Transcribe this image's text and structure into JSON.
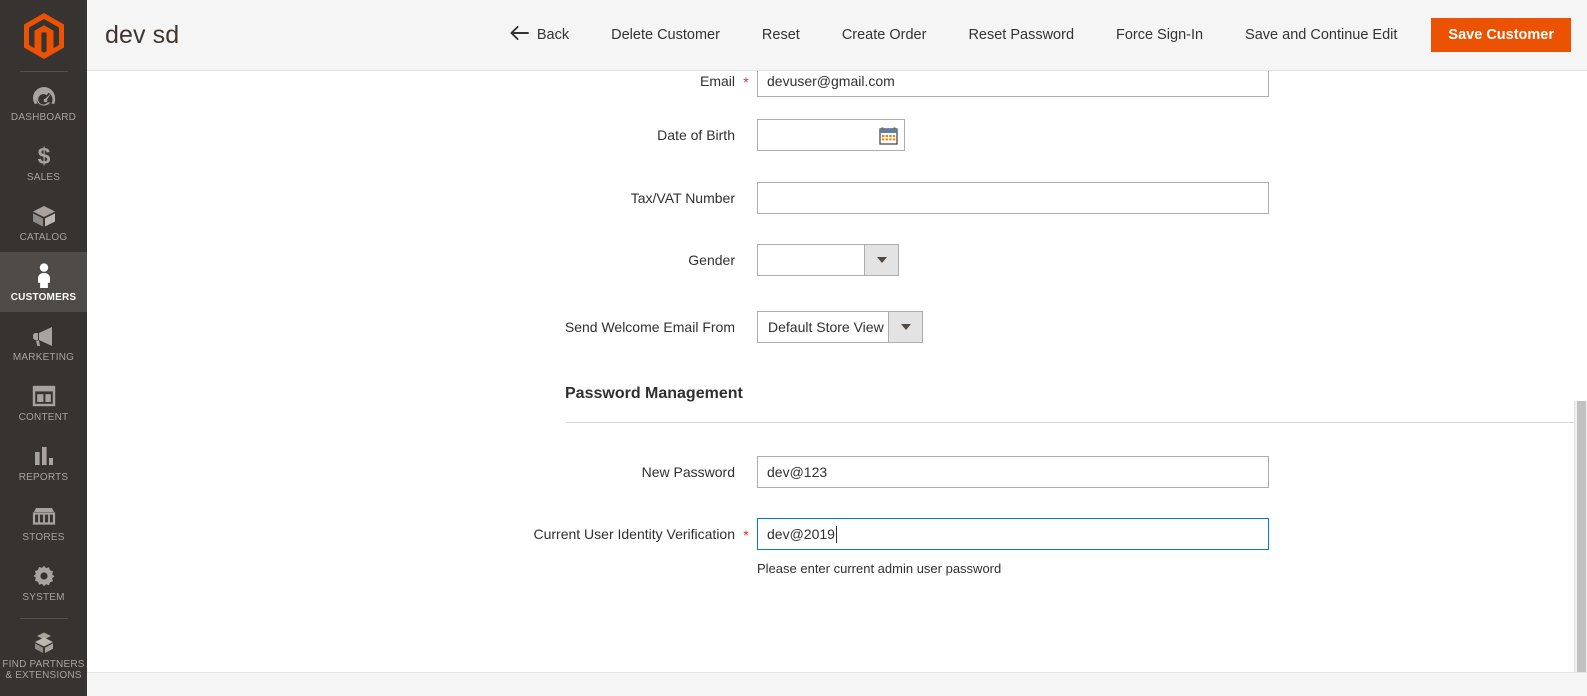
{
  "sidebar": {
    "logo_name": "magento-logo",
    "items": [
      {
        "label": "DASHBOARD",
        "icon": "dashboard-icon",
        "active": false
      },
      {
        "label": "SALES",
        "icon": "dollar-icon",
        "active": false
      },
      {
        "label": "CATALOG",
        "icon": "box-icon",
        "active": false
      },
      {
        "label": "CUSTOMERS",
        "icon": "person-icon",
        "active": true
      },
      {
        "label": "MARKETING",
        "icon": "megaphone-icon",
        "active": false
      },
      {
        "label": "CONTENT",
        "icon": "layout-icon",
        "active": false
      },
      {
        "label": "REPORTS",
        "icon": "bar-chart-icon",
        "active": false
      },
      {
        "label": "STORES",
        "icon": "storefront-icon",
        "active": false
      },
      {
        "label": "SYSTEM",
        "icon": "gear-icon",
        "active": false
      },
      {
        "label": "FIND PARTNERS\n& EXTENSIONS",
        "label_line1": "FIND PARTNERS",
        "label_line2": "& EXTENSIONS",
        "icon": "partners-box-icon",
        "active": false
      }
    ]
  },
  "header": {
    "title": "dev sd",
    "actions": [
      {
        "label": "Back",
        "icon": "arrow-left-icon",
        "primary": false
      },
      {
        "label": "Delete Customer",
        "primary": false
      },
      {
        "label": "Reset",
        "primary": false
      },
      {
        "label": "Create Order",
        "primary": false
      },
      {
        "label": "Reset Password",
        "primary": false
      },
      {
        "label": "Force Sign-In",
        "primary": false
      },
      {
        "label": "Save and Continue Edit",
        "primary": false
      }
    ],
    "save_label": "Save Customer"
  },
  "form": {
    "fields": [
      {
        "label": "Email",
        "required": true,
        "value": "devuser@gmail.com",
        "type": "text"
      },
      {
        "label": "Date of Birth",
        "required": false,
        "value": "",
        "type": "date"
      },
      {
        "label": "Tax/VAT Number",
        "required": false,
        "value": "",
        "type": "text"
      },
      {
        "label": "Gender",
        "required": false,
        "value": "",
        "type": "select"
      },
      {
        "label": "Send Welcome Email From",
        "required": false,
        "value": "Default Store View",
        "type": "select"
      }
    ],
    "password_section": {
      "heading": "Password Management",
      "new_password": {
        "label": "New Password",
        "required": false,
        "value": "dev@123"
      },
      "identity_verification": {
        "label": "Current User Identity Verification",
        "required": true,
        "value": "dev@2019",
        "help": "Please enter current admin user password",
        "focused": true
      }
    }
  },
  "colors": {
    "brand_orange": "#eb5202",
    "sidebar_bg": "#373330",
    "sidebar_active": "#4f4b48",
    "focus_blue": "#007bdb",
    "required_red": "#e02b27",
    "header_bg": "#f5f5f5"
  }
}
